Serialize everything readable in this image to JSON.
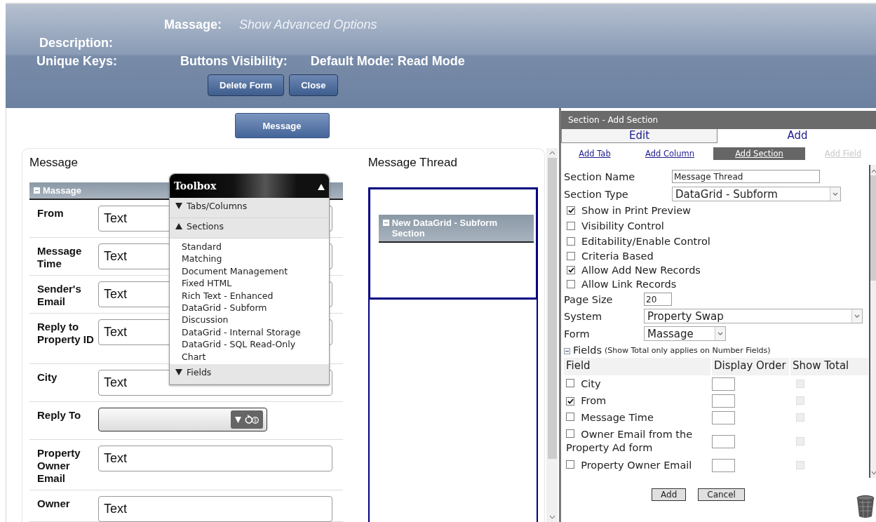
{
  "header": {
    "form_label": "Massage:",
    "advanced_link": "Show Advanced Options",
    "description_label": "Description:",
    "unique_keys_label": "Unique Keys:",
    "buttons_visibility_label": "Buttons Visibility:",
    "default_mode": "Default Mode: Read Mode",
    "buttons": [
      "Delete Form",
      "Close"
    ]
  },
  "tab_button": "Message",
  "left_column": {
    "title": "Message",
    "section": {
      "title": "Massage",
      "expanded": true,
      "fields": [
        {
          "label": "From",
          "kind": "text",
          "value": "Text"
        },
        {
          "label": "Message Time",
          "kind": "text",
          "value": "Text"
        },
        {
          "label": "Sender's Email",
          "kind": "text",
          "value": "Text"
        },
        {
          "label": "Reply to Property ID",
          "kind": "text",
          "value": "Text"
        },
        {
          "label": "City",
          "kind": "text",
          "value": "Text"
        },
        {
          "label": "Reply To",
          "kind": "lookup"
        },
        {
          "label": "Property Owner Email",
          "kind": "text",
          "value": "Text"
        },
        {
          "label": "Owner",
          "kind": "text",
          "value": "Text"
        }
      ]
    }
  },
  "right_column": {
    "title": "Message Thread",
    "section": {
      "title": "New DataGrid - Subform Section",
      "expanded": true
    }
  },
  "toolbox": {
    "title": "Toolbox",
    "expanded": true,
    "groups": [
      {
        "label": "Tabs/Columns",
        "expanded": false
      },
      {
        "label": "Sections",
        "expanded": true,
        "items": [
          "Standard",
          "Matching",
          "Document Management",
          "Fixed HTML",
          "Rich Text - Enhanced",
          "DataGrid - Subform",
          "Discussion",
          "DataGrid - Internal Storage",
          "DataGrid - SQL Read-Only",
          "Chart"
        ]
      },
      {
        "label": "Fields",
        "expanded": false
      }
    ]
  },
  "panel": {
    "title": "Section - Add Section",
    "tabs": [
      {
        "label": "Edit",
        "selected": false
      },
      {
        "label": "Add",
        "selected": true
      }
    ],
    "links": [
      {
        "label": "Add Tab",
        "selected": false,
        "disabled": false
      },
      {
        "label": "Add Column",
        "selected": false,
        "disabled": false
      },
      {
        "label": "Add Section",
        "selected": true,
        "disabled": false
      },
      {
        "label": "Add Field",
        "selected": false,
        "disabled": true
      }
    ],
    "section_name": {
      "label": "Section Name",
      "value": "Message Thread"
    },
    "section_type": {
      "label": "Section Type",
      "value": "DataGrid - Subform"
    },
    "options": [
      {
        "label": "Show in Print Preview",
        "checked": true
      },
      {
        "label": "Visibility Control",
        "checked": false
      },
      {
        "label": "Editability/Enable Control",
        "checked": false
      },
      {
        "label": "Criteria Based",
        "checked": false
      },
      {
        "label": "Allow Add New Records",
        "checked": true
      },
      {
        "label": "Allow Link Records",
        "checked": false
      }
    ],
    "page_size": {
      "label": "Page Size",
      "value": "20"
    },
    "system": {
      "label": "System",
      "value": "Property Swap"
    },
    "form": {
      "label": "Form",
      "value": "Massage"
    },
    "fields": {
      "heading": "Fields",
      "note": "(Show Total only applies on Number Fields)",
      "expanded": true,
      "columns": [
        "Field",
        "Display Order",
        "Show Total"
      ],
      "rows": [
        {
          "name": "City",
          "checked": false,
          "show_total_disabled": true
        },
        {
          "name": "From",
          "checked": true,
          "show_total_disabled": true
        },
        {
          "name": "Message Time",
          "checked": false,
          "show_total_disabled": true
        },
        {
          "name": "Owner Email from the Property Ad form",
          "checked": false,
          "show_total_disabled": true
        },
        {
          "name": "Property Owner Email",
          "checked": false,
          "show_total_disabled": true
        }
      ]
    },
    "buttons": [
      "Add",
      "Cancel"
    ]
  }
}
